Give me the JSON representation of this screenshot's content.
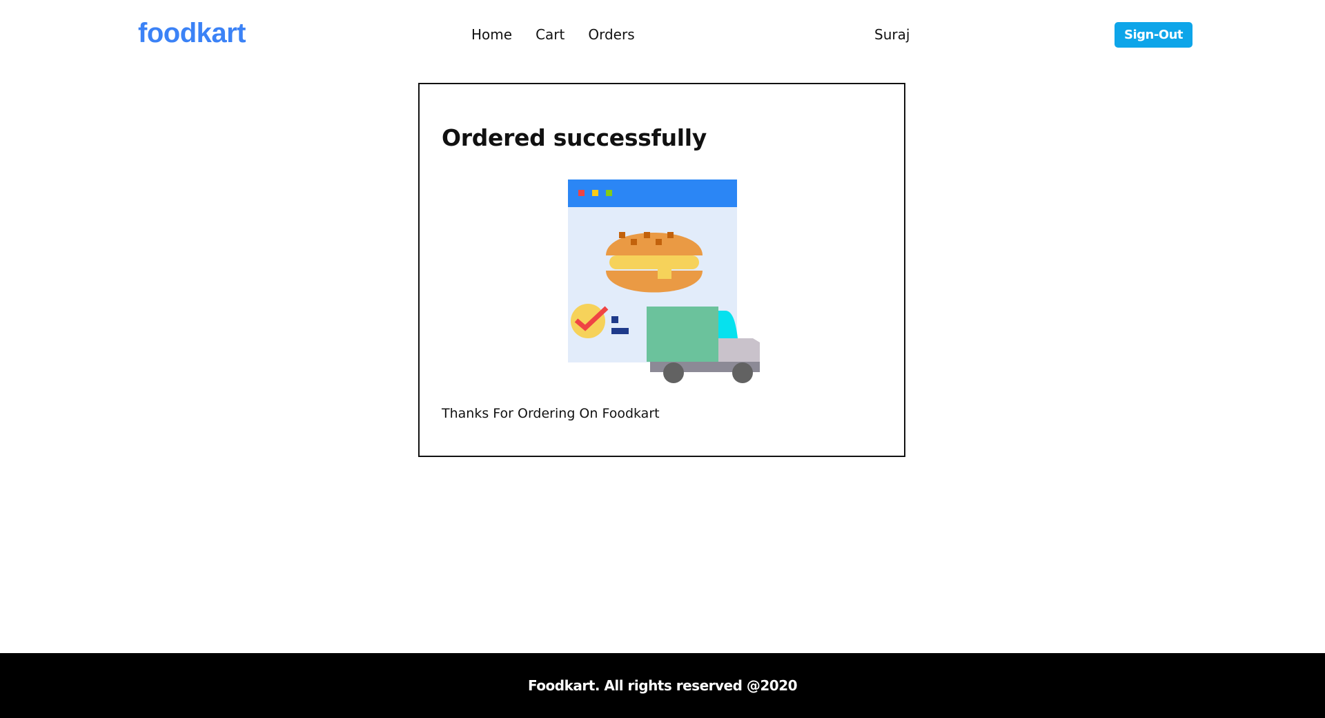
{
  "header": {
    "logo": "foodkart",
    "nav": [
      {
        "label": "Home"
      },
      {
        "label": "Cart"
      },
      {
        "label": "Orders"
      }
    ],
    "username": "Suraj",
    "signout_label": "Sign-Out"
  },
  "main": {
    "title": "Ordered successfully",
    "illustration_icon": "food-delivery-truck-illustration",
    "message": "Thanks For Ordering On Foodkart"
  },
  "footer": {
    "text": "Foodkart. All rights reserved @2020"
  },
  "colors": {
    "logo": "#3b82f6",
    "signout_button": "#0ea5e9",
    "footer_bg": "#000000"
  }
}
